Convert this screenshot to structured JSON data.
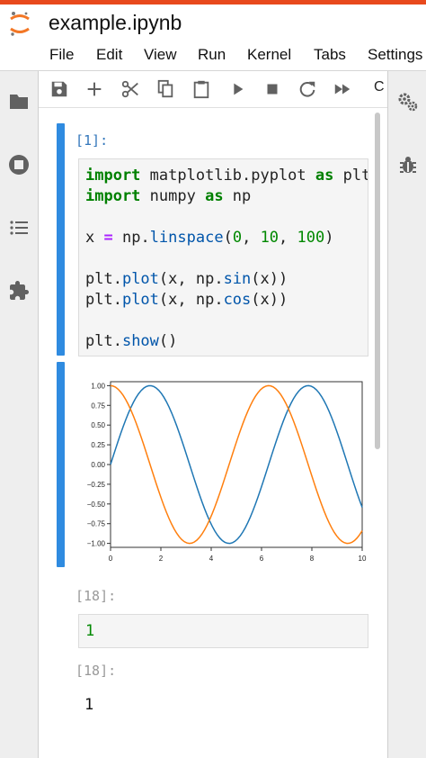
{
  "app": {
    "title": "example.ipynb",
    "accent_color": "#e8491d"
  },
  "menu": [
    "File",
    "Edit",
    "View",
    "Run",
    "Kernel",
    "Tabs",
    "Settings"
  ],
  "toolbar": {
    "buttons": [
      "save-icon",
      "add-cell-icon",
      "cut-icon",
      "copy-icon",
      "paste-icon",
      "run-icon",
      "stop-icon",
      "restart-icon",
      "fast-forward-icon"
    ],
    "cell_type_label": "C"
  },
  "left_sidebar": [
    "folder-icon",
    "running-icon",
    "list-icon",
    "extension-icon"
  ],
  "right_sidebar": [
    "property-inspector-icon",
    "debugger-icon"
  ],
  "cells": [
    {
      "prompt": "[1]:",
      "code_lines": [
        "import matplotlib.pyplot as plt",
        "import numpy as np",
        "",
        "x = np.linspace(0, 10, 100)",
        "",
        "plt.plot(x, np.sin(x))",
        "plt.plot(x, np.cos(x))",
        "",
        "plt.show()"
      ]
    },
    {
      "prompt": "[18]:",
      "code": "1"
    },
    {
      "prompt": "[18]:",
      "output": "1"
    }
  ],
  "chart_data": {
    "type": "line",
    "xlim": [
      0,
      10
    ],
    "ylim": [
      -1.05,
      1.05
    ],
    "x_ticks": [
      "0",
      "2",
      "4",
      "6",
      "8",
      "10"
    ],
    "y_ticks": [
      "1.00",
      "0.75",
      "0.50",
      "0.25",
      "0.00",
      "−0.25",
      "−0.50",
      "−0.75",
      "−1.00"
    ],
    "grid": false,
    "series": [
      {
        "function": "sin",
        "color": "#1f77b4",
        "x": [
          0,
          10
        ],
        "samples": 100
      },
      {
        "function": "cos",
        "color": "#ff7f0e",
        "x": [
          0,
          10
        ],
        "samples": 100
      }
    ]
  }
}
